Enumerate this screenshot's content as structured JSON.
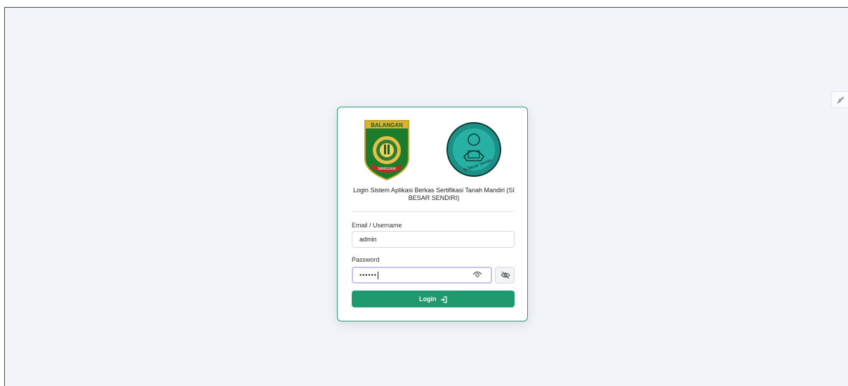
{
  "login": {
    "title": "Login Sistem Aplikasi Berkas Sertifikasi Tanah Mandiri (SI BESAR SENDIRI)",
    "email_label": "Email / Username",
    "email_value": "admin",
    "password_label": "Password",
    "password_value": "••••••",
    "login_button": "Login"
  },
  "logos": {
    "left_banner_text": "BALANGAN",
    "left_ribbon_text": "SANGGAM",
    "right_text": "Si Besar Sendiri"
  },
  "colors": {
    "accent": "#1f9a6e",
    "card_border": "#2d9b73",
    "focus_ring": "#c8bff2",
    "background": "#f1f4f8"
  },
  "icons": {
    "password_toggle": "eye-icon",
    "password_hide": "eye-off-icon",
    "login": "sign-in-icon",
    "side": "rocket-icon"
  }
}
